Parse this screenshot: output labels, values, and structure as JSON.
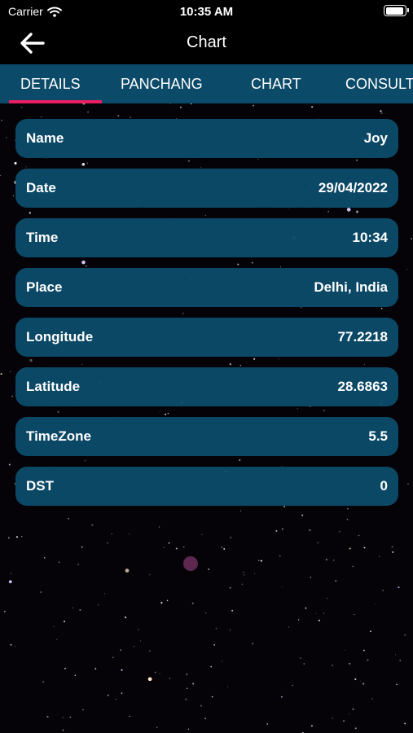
{
  "status_bar": {
    "carrier": "Carrier",
    "time": "10:35 AM",
    "icons": [
      "wifi-icon",
      "battery-icon"
    ]
  },
  "header": {
    "title": "Chart",
    "back_icon": "arrow-left-icon"
  },
  "tabs": [
    {
      "label": "DETAILS",
      "active": true
    },
    {
      "label": "PANCHANG",
      "active": false
    },
    {
      "label": "CHART",
      "active": false
    },
    {
      "label": "CONSULT",
      "active": false
    }
  ],
  "details": [
    {
      "label": "Name",
      "value": "Joy"
    },
    {
      "label": "Date",
      "value": "29/04/2022"
    },
    {
      "label": "Time",
      "value": "10:34"
    },
    {
      "label": "Place",
      "value": "Delhi, India"
    },
    {
      "label": "Longitude",
      "value": "77.2218"
    },
    {
      "label": "Latitude",
      "value": "28.6863"
    },
    {
      "label": "TimeZone",
      "value": "5.5"
    },
    {
      "label": "DST",
      "value": "0"
    }
  ],
  "colors": {
    "tab_bar": "#0b4a68",
    "row_background": "#0b4a68",
    "active_tab_indicator": "#e91e63",
    "background": "#050308"
  }
}
